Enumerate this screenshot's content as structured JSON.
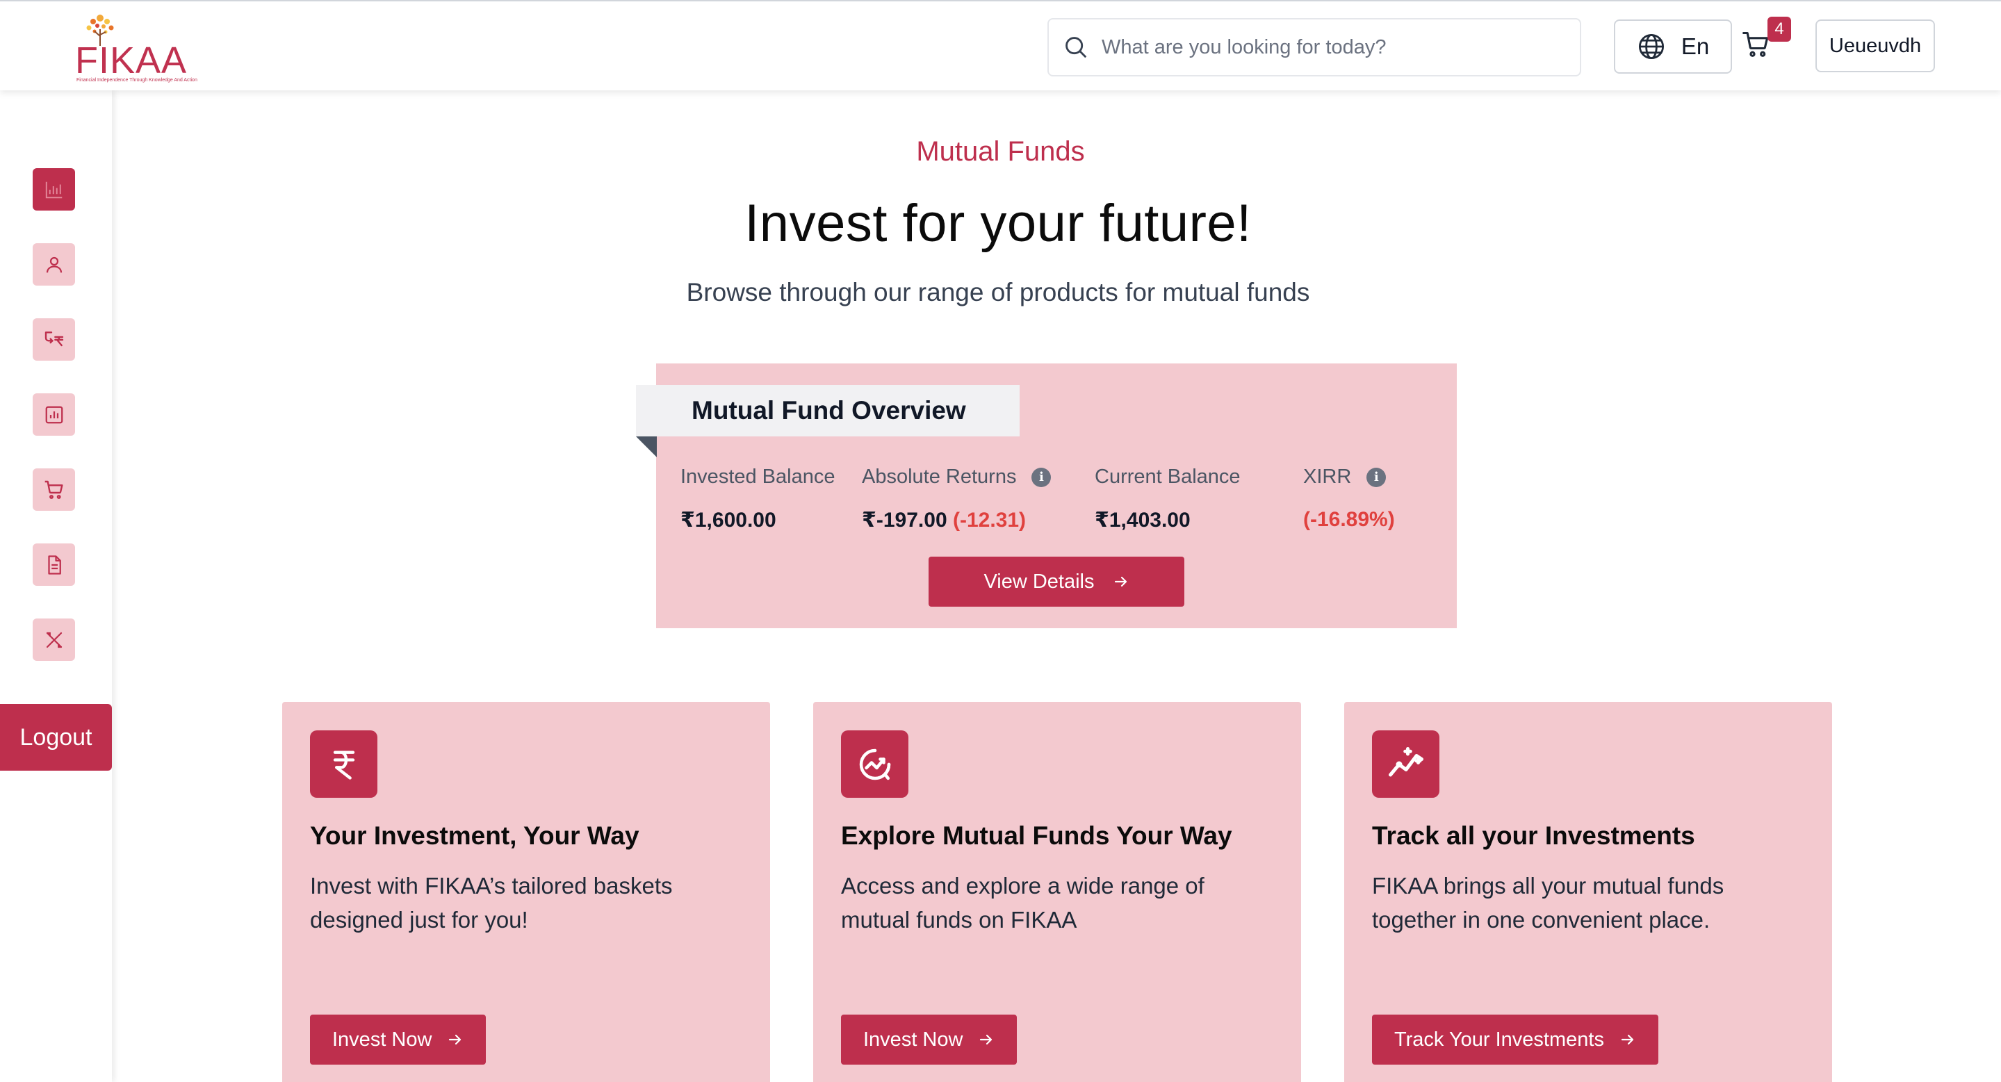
{
  "brand": {
    "name": "FIKAA",
    "tagline": "Financial Independence Through Knowledge And Action",
    "accent_color": "#be2f4d",
    "card_color": "#f3c9cf"
  },
  "header": {
    "search_placeholder": "What are you looking for today?",
    "language": "En",
    "cart_count": "4",
    "user_name": "Ueueuvdh"
  },
  "sidebar": {
    "items": [
      {
        "icon": "dashboard-chart-icon",
        "active": true
      },
      {
        "icon": "user-icon",
        "active": false
      },
      {
        "icon": "rupee-transfer-icon",
        "active": false
      },
      {
        "icon": "bar-chart-icon",
        "active": false
      },
      {
        "icon": "cart-icon",
        "active": false
      },
      {
        "icon": "document-icon",
        "active": false
      },
      {
        "icon": "tools-icon",
        "active": false
      }
    ],
    "logout_label": "Logout"
  },
  "hero": {
    "eyebrow": "Mutual Funds",
    "title": "Invest for your future!",
    "subtitle": "Browse through our range of products for mutual funds"
  },
  "overview": {
    "title": "Mutual Fund Overview",
    "invested_label": "Invested Balance",
    "invested_value": "₹1,600.00",
    "returns_label": "Absolute Returns",
    "returns_value": "₹-197.00",
    "returns_pct": "(-12.31)",
    "current_label": "Current Balance",
    "current_value": "₹1,403.00",
    "xirr_label": "XIRR",
    "xirr_value": "(-16.89%)",
    "button": "View Details"
  },
  "features": [
    {
      "icon": "rupee-icon",
      "title": "Your Investment, Your Way",
      "desc": "Invest with FIKAA’s tailored baskets designed just for you!",
      "button": "Invest Now"
    },
    {
      "icon": "explore-growth-icon",
      "title": "Explore Mutual Funds Your Way",
      "desc": "Access and explore a wide range of mutual funds on FIKAA",
      "button": "Invest Now"
    },
    {
      "icon": "sparkle-trend-icon",
      "title": "Track all your Investments",
      "desc": "FIKAA brings all your mutual funds together in one convenient place.",
      "button": "Track Your Investments"
    }
  ]
}
